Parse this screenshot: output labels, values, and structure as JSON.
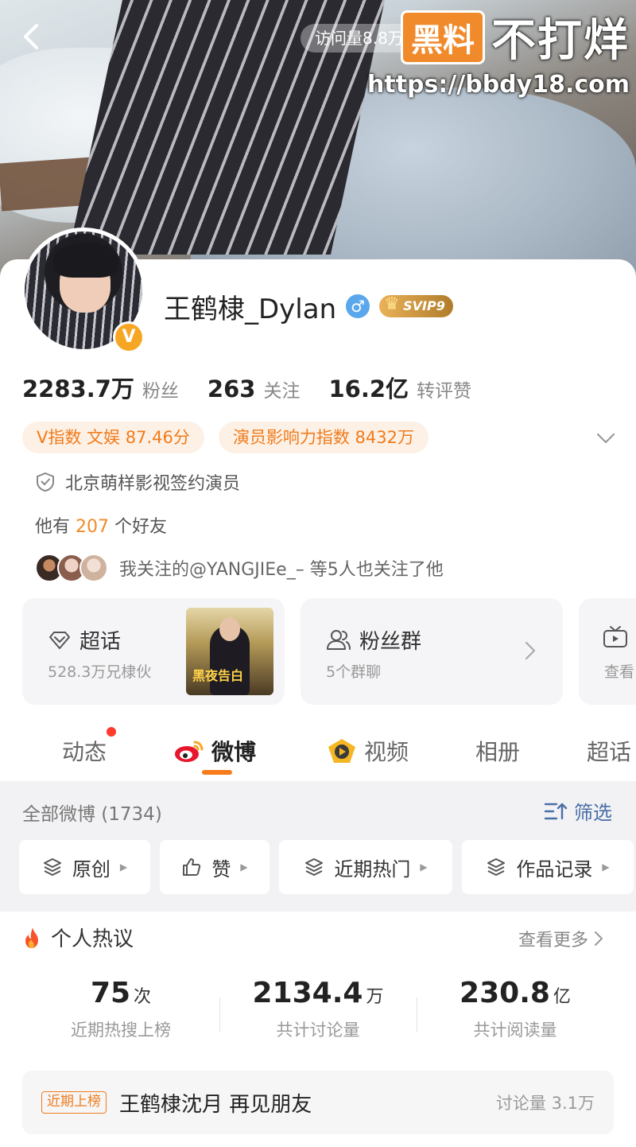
{
  "header": {
    "visitors_text": "访问量8.8万",
    "watermark": {
      "badge": "黑料",
      "text": "不打烊",
      "url": "https://bbdy18.com"
    }
  },
  "profile": {
    "name": "王鹤棣_Dylan",
    "gender_symbol": "♂",
    "vip_label": "SVIP9",
    "verified_badge": "V",
    "stats": [
      {
        "value": "2283.7万",
        "label": "粉丝"
      },
      {
        "value": "263",
        "label": "关注"
      },
      {
        "value": "16.2亿",
        "label": "转评赞"
      }
    ],
    "tags": [
      "V指数 文娱 87.46分",
      "演员影响力指数 8432万"
    ],
    "verification": "北京萌样影视签约演员",
    "friends": {
      "prefix": "他有",
      "count": "207",
      "suffix": "个好友"
    },
    "mutual_follow": "我关注的@YANGJIEe_– 等5人也关注了他"
  },
  "features": [
    {
      "title": "超话",
      "subtitle": "528.3万兄棣伙",
      "thumb_text": "黑夜告白"
    },
    {
      "title": "粉丝群",
      "subtitle": "5个群聊"
    },
    {
      "title": "查看"
    }
  ],
  "tabs": [
    {
      "label": "动态"
    },
    {
      "label": "微博"
    },
    {
      "label": "视频"
    },
    {
      "label": "相册"
    },
    {
      "label": "超话"
    }
  ],
  "feed": {
    "all_label": "全部微博 (1734)",
    "filter_label": "筛选",
    "chips": [
      "原创",
      "赞",
      "近期热门",
      "作品记录"
    ]
  },
  "discussion": {
    "title": "个人热议",
    "see_more": "查看更多",
    "metrics": [
      {
        "value": "75",
        "unit": "次",
        "label": "近期热搜上榜"
      },
      {
        "value": "2134.4",
        "unit": "万",
        "label": "共计讨论量"
      },
      {
        "value": "230.8",
        "unit": "亿",
        "label": "共计阅读量"
      }
    ],
    "trend": {
      "badge": "近期上榜",
      "title": "王鹤棣沈月 再见朋友",
      "count": "讨论量 3.1万"
    }
  },
  "colors": {
    "accent": "#f97c1b",
    "link_blue": "#4a6fa8",
    "vip_gold": "#e9b25a",
    "verify_orange": "#f6a623"
  }
}
